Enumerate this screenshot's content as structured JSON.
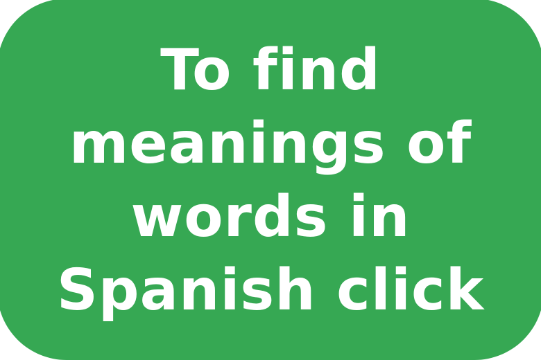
{
  "cta": {
    "lines": [
      "To find",
      "meanings of",
      "words in",
      "Spanish click"
    ],
    "background_color": "#36a853",
    "text_color": "#ffffff"
  }
}
